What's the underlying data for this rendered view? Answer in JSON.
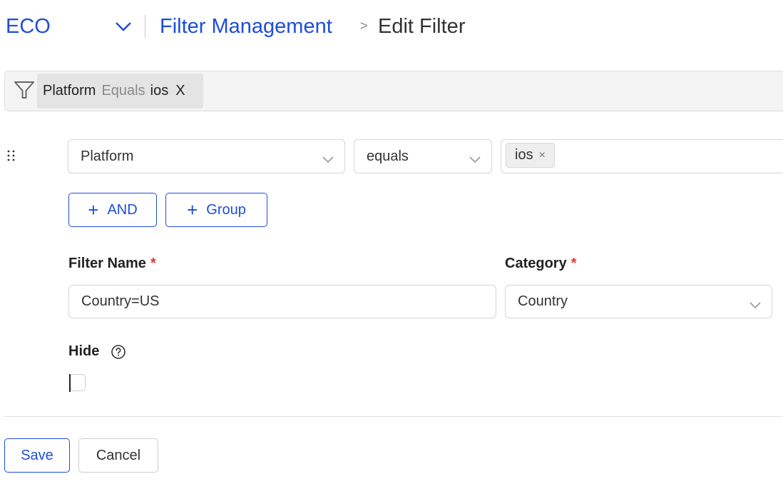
{
  "header": {
    "app_name": "ECO",
    "breadcrumb_link": "Filter Management",
    "breadcrumb_separator": ">",
    "breadcrumb_current": "Edit Filter"
  },
  "summary_chip": {
    "field": "Platform",
    "operator": "Equals",
    "value": "ios",
    "remove_glyph": "X"
  },
  "condition": {
    "field": "Platform",
    "operator": "equals",
    "values": [
      "ios"
    ],
    "tag_remove_glyph": "×"
  },
  "builder_buttons": {
    "and_label": "AND",
    "group_label": "Group",
    "plus_glyph": "+"
  },
  "form": {
    "filter_name_label": "Filter Name",
    "filter_name_value": "Country=US",
    "category_label": "Category",
    "category_value": "Country",
    "required_mark": "*",
    "hide_label": "Hide",
    "hide_checked": false
  },
  "footer": {
    "save_label": "Save",
    "cancel_label": "Cancel"
  },
  "colors": {
    "accent": "#1d4ed8",
    "required": "#e03a3a",
    "border": "#d6d6d6"
  },
  "icons": {
    "app_switch": "chevron-down-icon",
    "filter": "funnel-icon",
    "drag": "drag-handle-icon",
    "dropdown": "chevron-down-icon",
    "help": "help-circle-icon"
  }
}
